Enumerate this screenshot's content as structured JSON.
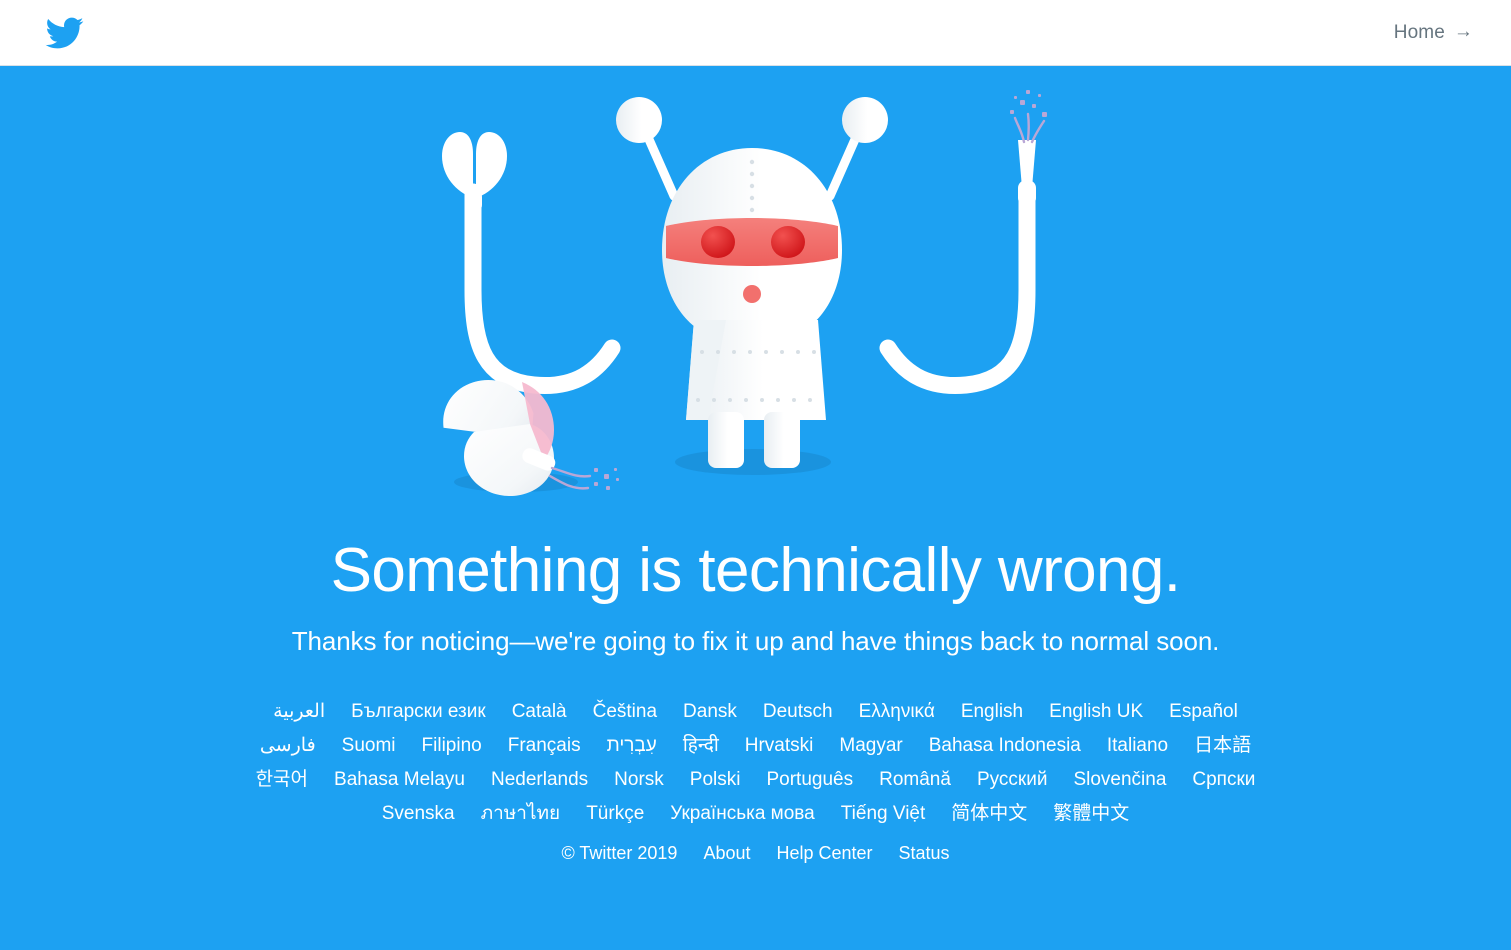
{
  "header": {
    "logo_icon": "twitter-bird-icon",
    "logo_color": "#1da1f2",
    "home_label": "Home",
    "home_arrow": "→"
  },
  "illustration": {
    "name": "broken-robot-illustration",
    "background_color": "#1da1f2",
    "robot_body_color": "#ffffff",
    "visor_color": "#f2706d",
    "eye_color": "#e0252a",
    "mouth_color": "#f2706d",
    "shadow_color": "#1a93de",
    "spark_color": "#b9a7d6",
    "egg_inner_color": "#f6b9cf",
    "parts": [
      "antenna-left",
      "antenna-right",
      "head",
      "visor",
      "eye-left",
      "eye-right",
      "mouth",
      "torso",
      "arm-left-claw",
      "arm-right-frayed-wire",
      "leg-left",
      "leg-right",
      "cracked-sphere",
      "sparks"
    ]
  },
  "main": {
    "headline": "Something is technically wrong.",
    "subhead": "Thanks for noticing—we're going to fix it up and have things back to normal soon."
  },
  "languages": [
    "العربية",
    "Български език",
    "Català",
    "Čeština",
    "Dansk",
    "Deutsch",
    "Ελληνικά",
    "English",
    "English UK",
    "Español",
    "فارسی",
    "Suomi",
    "Filipino",
    "Français",
    "עִבְרִית",
    "हिन्दी",
    "Hrvatski",
    "Magyar",
    "Bahasa Indonesia",
    "Italiano",
    "日本語",
    "한국어",
    "Bahasa Melayu",
    "Nederlands",
    "Norsk",
    "Polski",
    "Português",
    "Română",
    "Русский",
    "Slovenčina",
    "Српски",
    "Svenska",
    "ภาษาไทย",
    "Türkçe",
    "Українська мова",
    "Tiếng Việt",
    "简体中文",
    "繁體中文"
  ],
  "footer": {
    "copyright": "© Twitter 2019",
    "links": [
      "About",
      "Help Center",
      "Status"
    ]
  }
}
